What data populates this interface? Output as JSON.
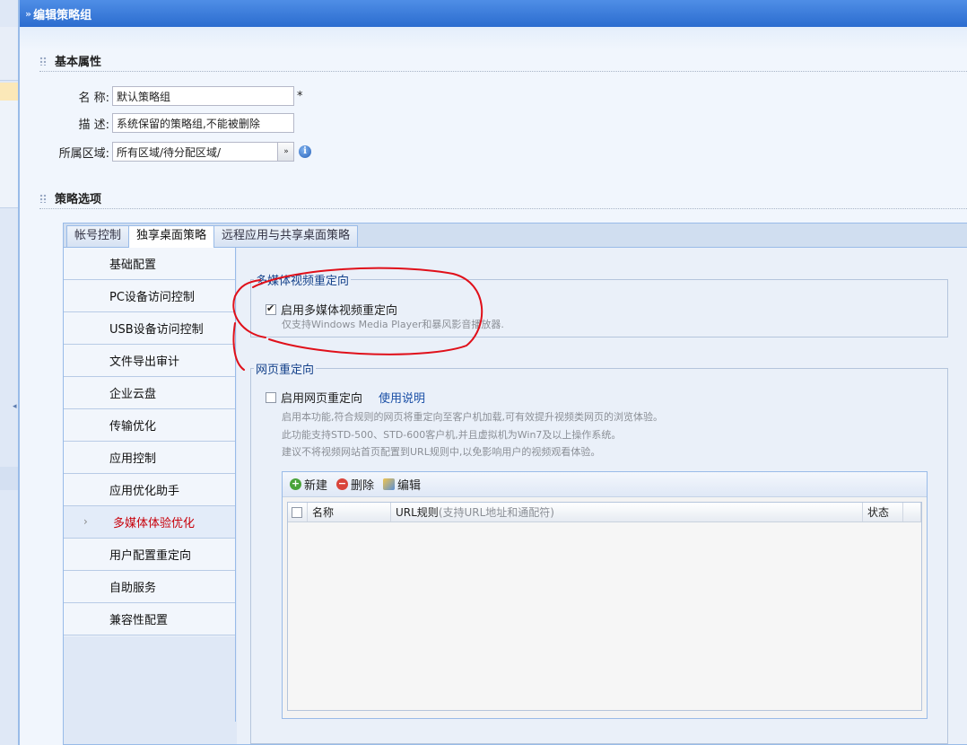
{
  "window": {
    "title": "编辑策略组"
  },
  "basic": {
    "section_title": "基本属性",
    "name_label": "名 称:",
    "name_value": "默认策略组",
    "required_mark": "*",
    "desc_label": "描 述:",
    "desc_value": "系统保留的策略组,不能被删除",
    "region_label": "所属区域:",
    "region_value": "所有区域/待分配区域/",
    "pick_button": "»",
    "info_icon": "i"
  },
  "policy": {
    "section_title": "策略选项",
    "tabs": [
      "帐号控制",
      "独享桌面策略",
      "远程应用与共享桌面策略"
    ],
    "active_tab": "独享桌面策略",
    "nav_items": [
      "基础配置",
      "PC设备访问控制",
      "USB设备访问控制",
      "文件导出审计",
      "企业云盘",
      "传输优化",
      "应用控制",
      "应用优化助手",
      "多媒体体验优化",
      "用户配置重定向",
      "自助服务",
      "兼容性配置"
    ],
    "selected_nav": "多媒体体验优化",
    "nav_arrow": "›"
  },
  "multimedia": {
    "legend": "多媒体视频重定向",
    "checkbox_label": "启用多媒体视频重定向",
    "checked": true,
    "hint": "仅支持Windows Media Player和暴风影音播放器."
  },
  "web_redirect": {
    "legend": "网页重定向",
    "checkbox_label": "启用网页重定向",
    "checked": false,
    "help_link": "使用说明",
    "hints": [
      "启用本功能,符合规则的网页将重定向至客户机加载,可有效提升视频类网页的浏览体验。",
      "此功能支持STD-500、STD-600客户机,并且虚拟机为Win7及以上操作系统。",
      "建议不将视频网站首页配置到URL规则中,以免影响用户的视频观看体验。"
    ],
    "toolbar": {
      "new_label": "新建",
      "delete_label": "删除",
      "edit_label": "编辑"
    },
    "grid": {
      "col_name": "名称",
      "col_url": "URL规则",
      "col_url_note": "(支持URL地址和通配符)",
      "col_status": "状态"
    }
  },
  "colors": {
    "title_bar": "#2b6ccf",
    "selected_nav_text": "#c8000a",
    "annotation": "#e0101a"
  }
}
